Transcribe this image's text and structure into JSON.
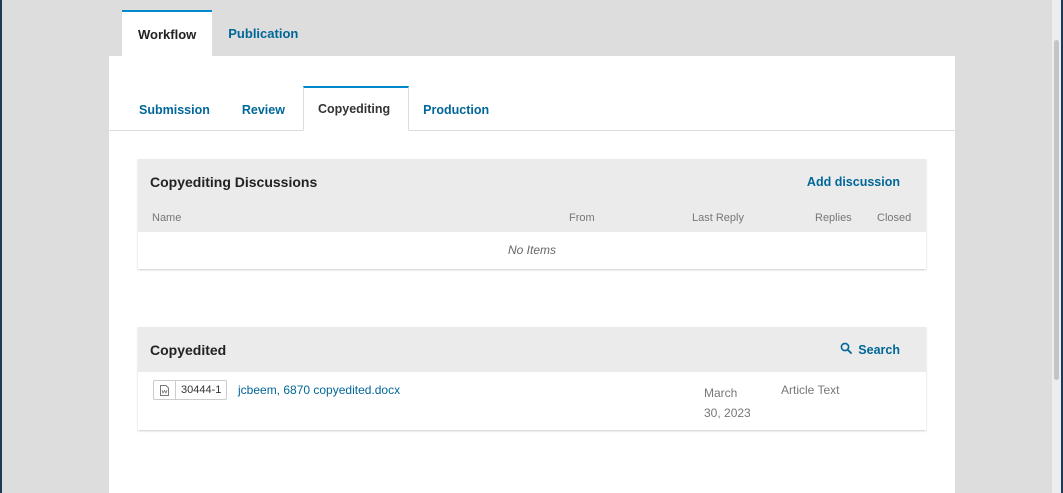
{
  "outer_tabs": [
    {
      "label": "Workflow",
      "active": true
    },
    {
      "label": "Publication",
      "active": false
    }
  ],
  "stage_tabs": [
    {
      "label": "Submission",
      "active": false
    },
    {
      "label": "Review",
      "active": false
    },
    {
      "label": "Copyediting",
      "active": true
    },
    {
      "label": "Production",
      "active": false
    }
  ],
  "discussions": {
    "title": "Copyediting Discussions",
    "action_label": "Add discussion",
    "columns": {
      "name": "Name",
      "from": "From",
      "last_reply": "Last Reply",
      "replies": "Replies",
      "closed": "Closed"
    },
    "empty_text": "No Items"
  },
  "copyedited": {
    "title": "Copyedited",
    "action_label": "Search",
    "action_icon": "search-icon",
    "files": [
      {
        "file_icon": "document-icon",
        "id": "30444-1",
        "name": "jcbeem, 6870 copyedited.docx",
        "date": "March 30, 2023",
        "type": "Article Text"
      }
    ]
  },
  "colors": {
    "link": "#006798",
    "accent": "#008acb",
    "header_bg": "#ebebeb",
    "page_bg": "#dddddd"
  }
}
